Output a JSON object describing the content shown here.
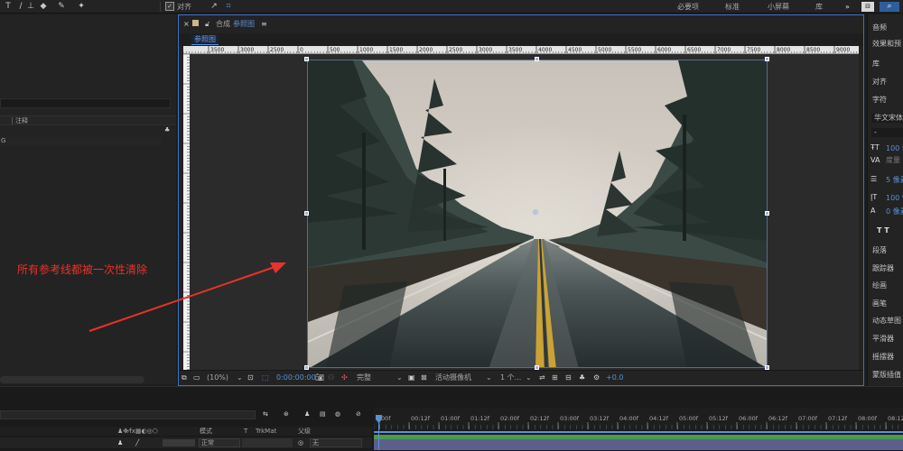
{
  "toolbar": {
    "align_checkbox_label": "对齐",
    "workspaces": [
      "必要项",
      "标准",
      "小屏幕",
      "库"
    ],
    "more": "»"
  },
  "left_panel": {
    "column_comment": "注释"
  },
  "viewer": {
    "tab_label": "合成",
    "comp_name": "参照图",
    "subtab": "参照图",
    "ruler_top_labels": [
      "3500",
      "3000",
      "2500",
      "0",
      "500",
      "1000",
      "1500",
      "2000",
      "2500",
      "3000",
      "3500",
      "4000",
      "4500",
      "5000",
      "5500",
      "6000",
      "6500",
      "7000",
      "7500",
      "8000",
      "8500",
      "9000"
    ],
    "bottom": {
      "zoom": "(10%)",
      "timecode": "0:00:00:00",
      "resolution": "完整",
      "camera": "活动摄像机",
      "views": "1 个...",
      "exposure": "+0.0"
    }
  },
  "annotation": {
    "text": "所有参考线都被一次性清除",
    "color": "#e8322b"
  },
  "right_panel": {
    "items": [
      {
        "label": "音频"
      },
      {
        "label": "效果和预"
      },
      {
        "label": "库"
      },
      {
        "label": "对齐"
      },
      {
        "label": "字符"
      },
      {
        "label": "华文宋体"
      },
      {
        "label": "-"
      },
      {
        "label": "100 像"
      },
      {
        "label": "度量"
      },
      {
        "label": "5 像素"
      },
      {
        "label": "100 %"
      },
      {
        "label": "0 像素"
      },
      {
        "label": "T T"
      },
      {
        "label": "段落"
      },
      {
        "label": "跟踪器"
      },
      {
        "label": "绘画"
      },
      {
        "label": "画笔"
      },
      {
        "label": "动态草图"
      },
      {
        "label": "平滑器"
      },
      {
        "label": "摇摆器"
      },
      {
        "label": "蒙版插值"
      }
    ]
  },
  "timeline": {
    "ruler_labels": [
      "00f",
      "00:12f",
      "01:00f",
      "01:12f",
      "02:00f",
      "02:12f",
      "03:00f",
      "03:12f",
      "04:00f",
      "04:12f",
      "05:00f",
      "05:12f",
      "06:00f",
      "06:12f",
      "07:00f",
      "07:12f",
      "08:00f",
      "08:12f"
    ],
    "columns": {
      "mode": "模式",
      "t": "T",
      "trkmat": "TrkMat",
      "parent": "父级"
    },
    "layer": {
      "mode_value": "正常",
      "parent_value": "无"
    }
  },
  "colors": {
    "accent": "#3d72c2",
    "annotation": "#e8322b",
    "timeline_bar": "#5b5f8c"
  }
}
